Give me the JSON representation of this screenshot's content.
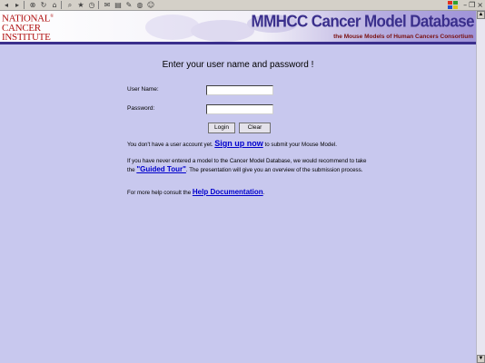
{
  "toolbar": {
    "icons": [
      "back-icon",
      "forward-icon",
      "stop-icon",
      "refresh-icon",
      "home-icon",
      "search-icon",
      "favorites-icon",
      "history-icon",
      "mail-icon",
      "print-icon",
      "edit-icon",
      "discuss-icon",
      "messenger-icon"
    ]
  },
  "window_controls": {
    "minimize": "–",
    "restore": "❐",
    "close": "×"
  },
  "header": {
    "logo_line1": "NATIONAL",
    "logo_line2": "CANCER",
    "logo_line3": "INSTITUTE",
    "logo_mark": "®",
    "title": "MMHCC Cancer Model Database",
    "subtitle": "the Mouse Models of Human Cancers Consortium"
  },
  "login": {
    "heading": "Enter your user name and password !",
    "username_label": "User Name:",
    "username_value": "",
    "password_label": "Password:",
    "password_value": "",
    "login_button": "Login",
    "clear_button": "Clear"
  },
  "info": {
    "signup_prefix": "You don't have a user account yet. ",
    "signup_link": "Sign up now",
    "signup_suffix": " to submit your Mouse Model.",
    "tour_prefix": "If you have never entered a model to the Cancer Model Database, we would recommend to take the ",
    "tour_link": "\"Guided Tour\"",
    "tour_suffix": ". The presentation will give you an overview of the submission process.",
    "help_prefix": "For more help consult the ",
    "help_link": "Help Documentation",
    "help_suffix": "."
  },
  "colors": {
    "page_background": "#c8c8ee",
    "link": "#0000cc",
    "header_accent": "#3a2f8c",
    "logo_red": "#b01010"
  }
}
